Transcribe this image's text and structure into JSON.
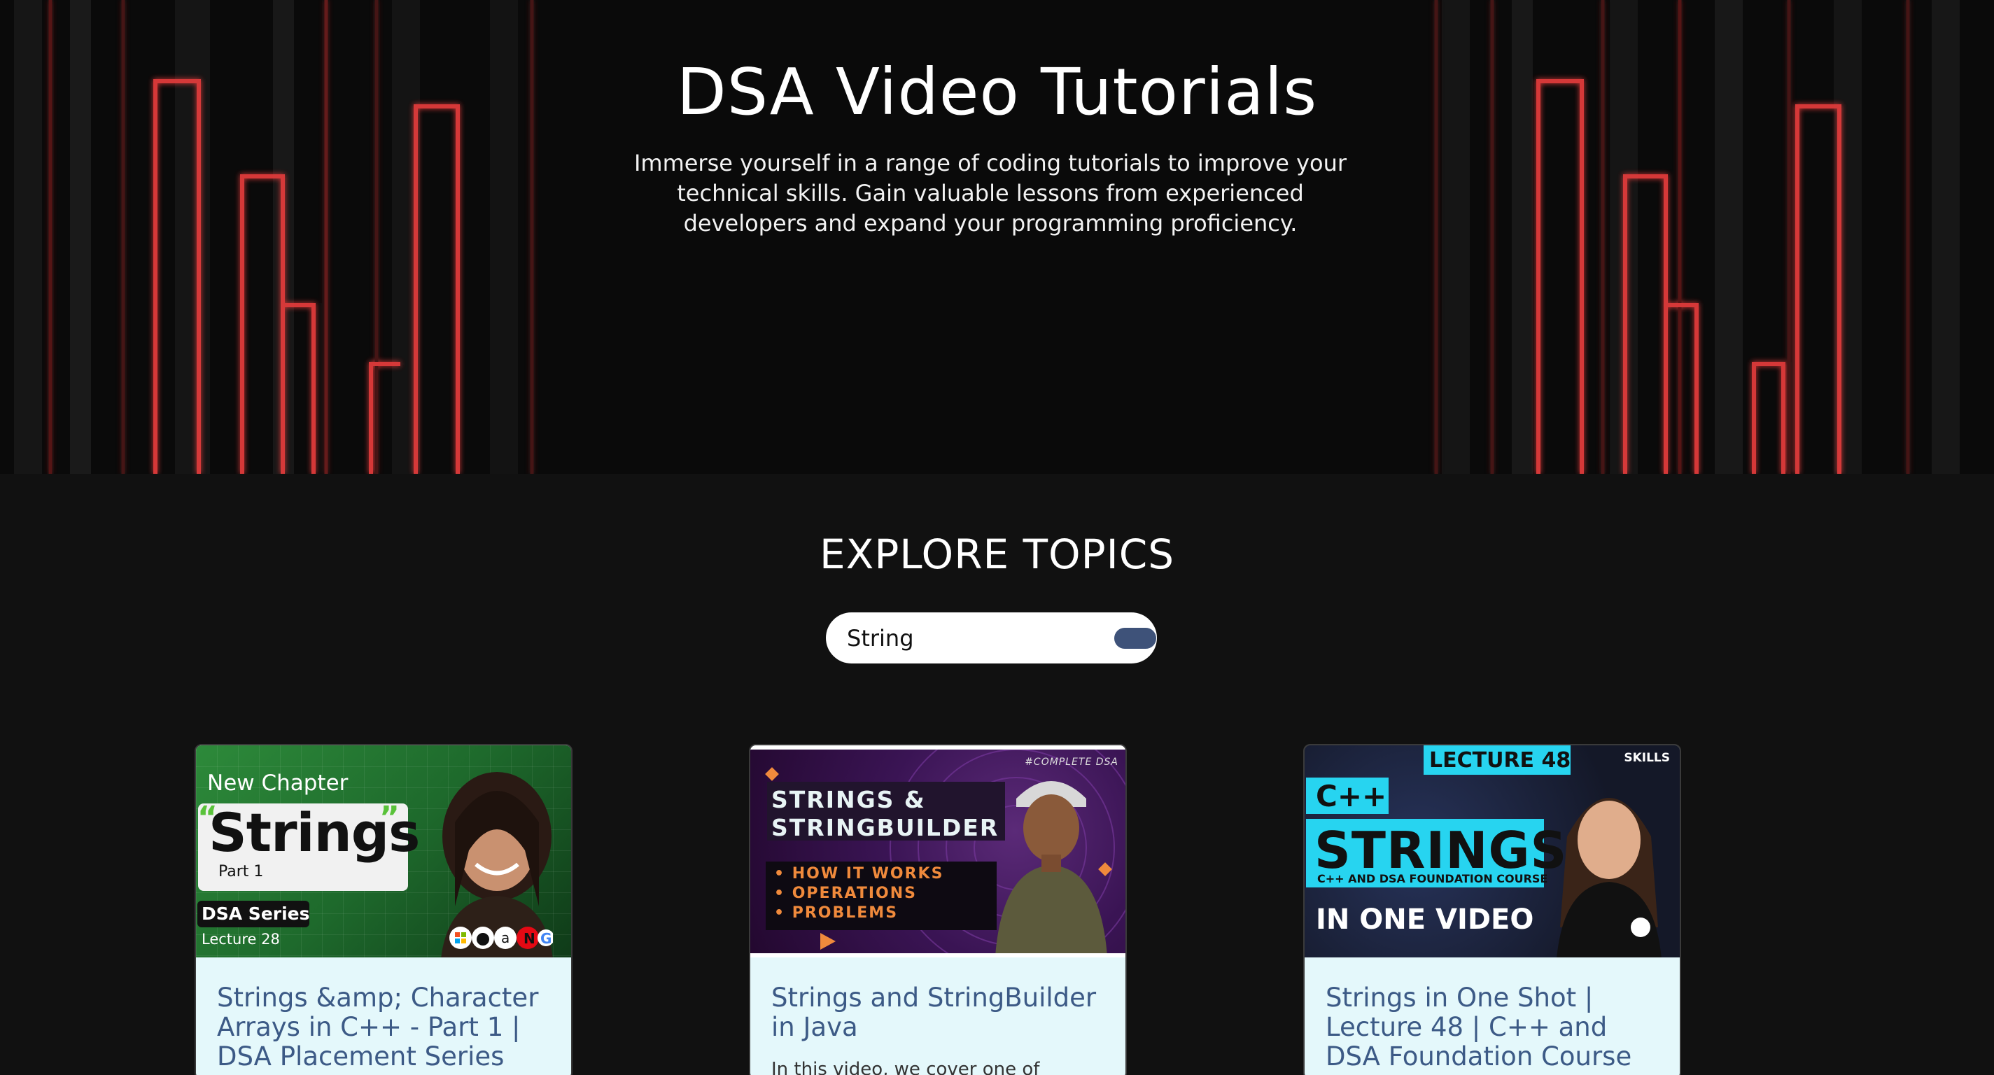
{
  "hero": {
    "title": "DSA Video Tutorials",
    "subtitle": "Immerse yourself in a range of coding tutorials to improve your technical skills. Gain valuable lessons from experienced developers and expand your programming proficiency."
  },
  "explore": {
    "title": "EXPLORE TOPICS",
    "search_value": "String"
  },
  "cards": [
    {
      "title": "Strings &amp; Character Arrays in C++ - Part 1 | DSA Placement Series",
      "description": "",
      "thumb": {
        "chapter": "New Chapter",
        "heading": "Strings",
        "quote_open": "“",
        "quote_close": "”",
        "part": "Part 1",
        "series": "DSA Series",
        "lecture": "Lecture 28"
      }
    },
    {
      "title": "Strings and StringBuilder in Java",
      "description": "In this video, we cover one of",
      "thumb": {
        "tag": "#COMPLETE DSA",
        "heading_line1": "STRINGS &",
        "heading_line2": "STRINGBUILDER",
        "points": [
          "• HOW IT WORKS",
          "• OPERATIONS",
          "• PROBLEMS"
        ]
      }
    },
    {
      "title": "Strings in One Shot | Lecture 48 | C++ and DSA Foundation Course",
      "description": "",
      "thumb": {
        "lecture": "LECTURE 48",
        "brand": "SKILLS",
        "language": "C++",
        "heading": "STRINGS",
        "course": "C++ AND DSA FOUNDATION COURSE",
        "tagline": "IN ONE VIDEO"
      }
    }
  ],
  "colors": {
    "page_bg": "#111111",
    "hero_bg": "#0a0a0a",
    "neon_red": "#e03a3a",
    "card_bg": "#e4f8fb",
    "card_title": "#3c5a86",
    "search_button": "#3e5279"
  }
}
